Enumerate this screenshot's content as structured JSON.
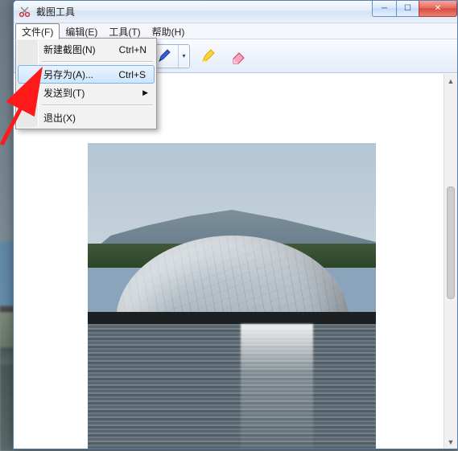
{
  "window": {
    "title": "截图工具"
  },
  "menubar": {
    "file": "文件(F)",
    "edit": "编辑(E)",
    "tools": "工具(T)",
    "help": "帮助(H)"
  },
  "file_menu": {
    "new_snip": {
      "label": "新建截图(N)",
      "shortcut": "Ctrl+N"
    },
    "save_as": {
      "label": "另存为(A)...",
      "shortcut": "Ctrl+S"
    },
    "send_to": {
      "label": "发送到(T)"
    },
    "exit": {
      "label": "退出(X)"
    }
  },
  "toolbar": {
    "new_dropdown": "▾",
    "pen_dropdown": "▾"
  },
  "icons": {
    "scissors": "app-scissors-icon",
    "new_snip": "new-snip-icon",
    "pen": "pen-icon",
    "highlighter": "highlighter-icon",
    "eraser": "eraser-icon",
    "minimize": "minimize-icon",
    "maximize": "maximize-icon",
    "close": "close-icon",
    "submenu_arrow": "▶"
  },
  "titlebar_buttons": {
    "min": "─",
    "max": "☐",
    "close": "✕"
  }
}
